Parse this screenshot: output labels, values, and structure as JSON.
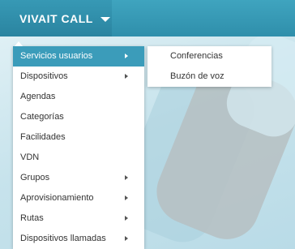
{
  "header": {
    "brand_label": "VIVAIT CALL"
  },
  "menu": {
    "items": [
      {
        "label": "Servicios usuarios",
        "has_submenu": true
      },
      {
        "label": "Dispositivos",
        "has_submenu": true
      },
      {
        "label": "Agendas",
        "has_submenu": false
      },
      {
        "label": "Categorías",
        "has_submenu": false
      },
      {
        "label": "Facilidades",
        "has_submenu": false
      },
      {
        "label": "VDN",
        "has_submenu": false
      },
      {
        "label": "Grupos",
        "has_submenu": true
      },
      {
        "label": "Aprovisionamiento",
        "has_submenu": true
      },
      {
        "label": "Rutas",
        "has_submenu": true
      },
      {
        "label": "Dispositivos llamadas",
        "has_submenu": true
      }
    ]
  },
  "submenu": {
    "items": [
      {
        "label": "Conferencias"
      },
      {
        "label": "Buzón de voz"
      }
    ]
  },
  "colors": {
    "topbar": "#3fa4bf",
    "active_item": "#3b9cba"
  }
}
